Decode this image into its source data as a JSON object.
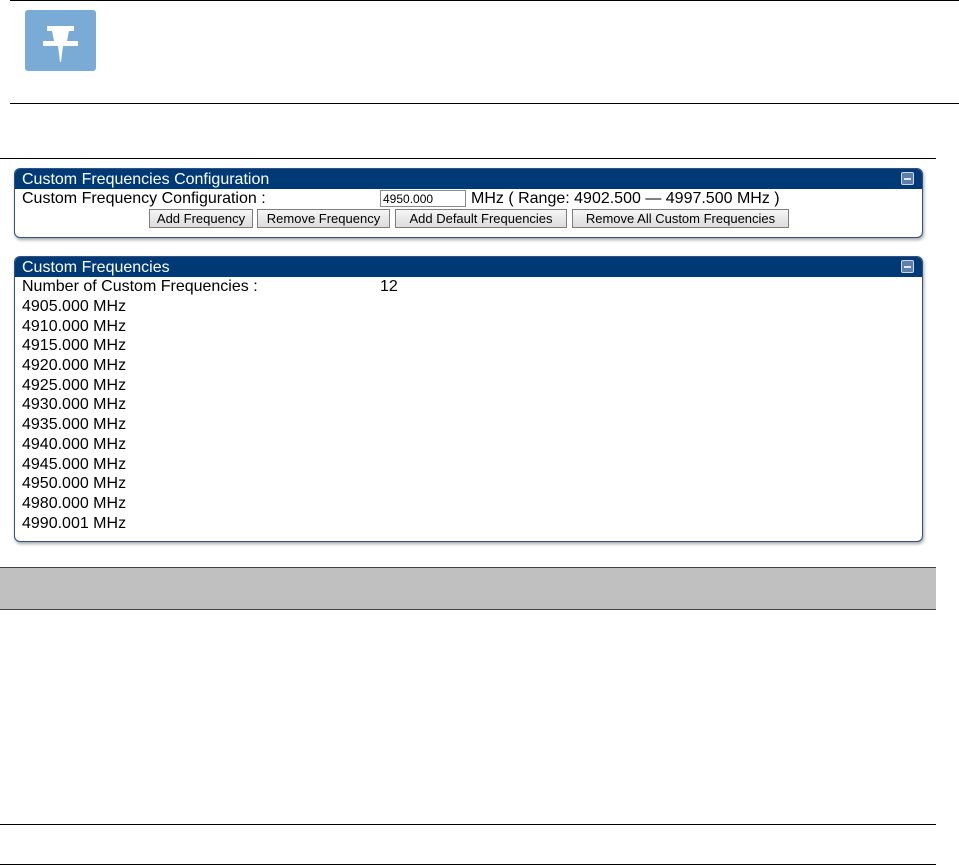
{
  "note": {
    "icon": "pin-icon"
  },
  "config_panel": {
    "title": "Custom Frequencies Configuration",
    "label": "Custom Frequency Configuration :",
    "input_value": "4950.000",
    "range_text": "MHz ( Range: 4902.500 — 4997.500 MHz )",
    "buttons": {
      "add": "Add Frequency",
      "remove": "Remove Frequency",
      "add_default": "Add Default Frequencies",
      "remove_all": "Remove All Custom Frequencies"
    }
  },
  "list_panel": {
    "title": "Custom Frequencies",
    "count_label": "Number of Custom Frequencies :",
    "count_value": "12",
    "frequencies": [
      "4905.000 MHz",
      "4910.000 MHz",
      "4915.000 MHz",
      "4920.000 MHz",
      "4925.000 MHz",
      "4930.000 MHz",
      "4935.000 MHz",
      "4940.000 MHz",
      "4945.000 MHz",
      "4950.000 MHz",
      "4980.000 MHz",
      "4990.001 MHz"
    ]
  },
  "colors": {
    "header_bg": "#003a76",
    "table_band": "#c0c0c0",
    "note_icon": "#7aaad6"
  }
}
